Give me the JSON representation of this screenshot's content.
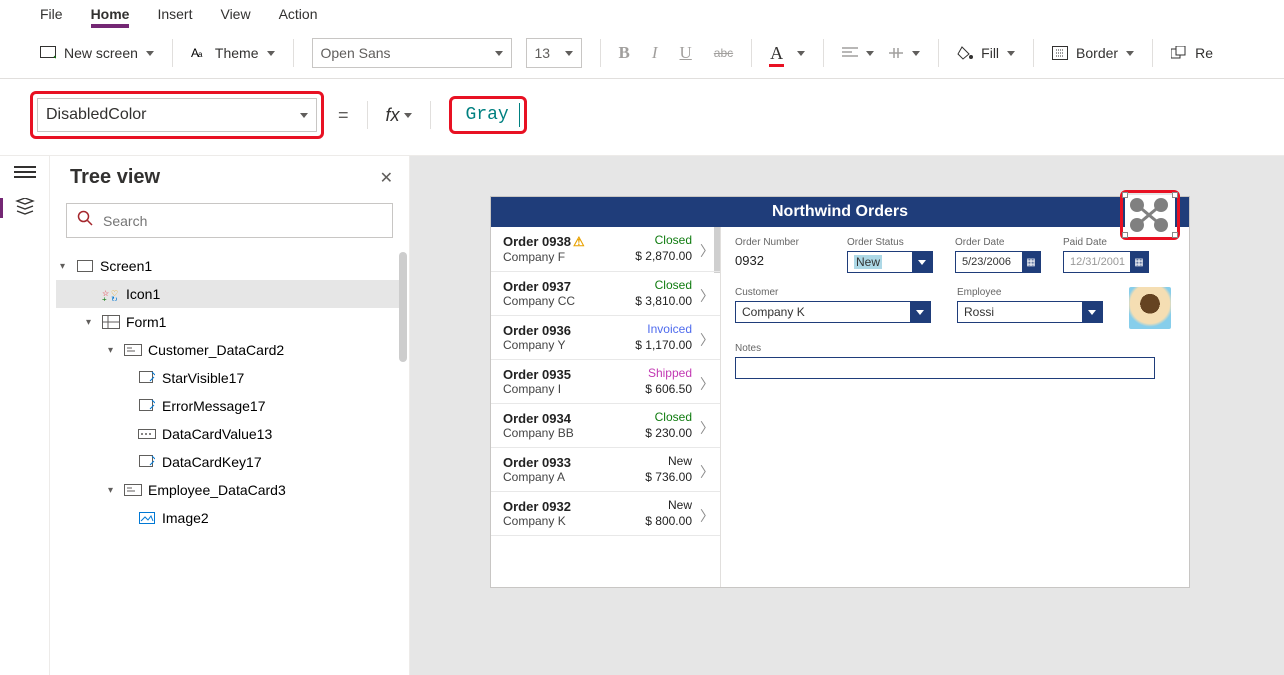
{
  "menu": {
    "file": "File",
    "home": "Home",
    "insert": "Insert",
    "view": "View",
    "action": "Action"
  },
  "toolbar": {
    "new_screen": "New screen",
    "theme": "Theme",
    "font_family": "Open Sans",
    "font_size": "13",
    "fill": "Fill",
    "border": "Border",
    "reorder": "Re"
  },
  "formula": {
    "property": "DisabledColor",
    "value": "Gray",
    "fx_label": "fx"
  },
  "panel": {
    "title": "Tree view",
    "search_placeholder": "Search"
  },
  "tree": {
    "screen1": "Screen1",
    "icon1": "Icon1",
    "form1": "Form1",
    "customer_card": "Customer_DataCard2",
    "starvisible": "StarVisible17",
    "errormessage": "ErrorMessage17",
    "datacardvalue": "DataCardValue13",
    "datacardkey": "DataCardKey17",
    "employee_card": "Employee_DataCard3",
    "image2": "Image2"
  },
  "app": {
    "title": "Northwind Orders",
    "list": [
      {
        "id": "Order 0938",
        "company": "Company F",
        "status": "Closed",
        "status_class": "st-closed",
        "amount": "$ 2,870.00",
        "warn": true
      },
      {
        "id": "Order 0937",
        "company": "Company CC",
        "status": "Closed",
        "status_class": "st-closed",
        "amount": "$ 3,810.00",
        "warn": false
      },
      {
        "id": "Order 0936",
        "company": "Company Y",
        "status": "Invoiced",
        "status_class": "st-invoiced",
        "amount": "$ 1,170.00",
        "warn": false
      },
      {
        "id": "Order 0935",
        "company": "Company I",
        "status": "Shipped",
        "status_class": "st-shipped",
        "amount": "$ 606.50",
        "warn": false
      },
      {
        "id": "Order 0934",
        "company": "Company BB",
        "status": "Closed",
        "status_class": "st-closed",
        "amount": "$ 230.00",
        "warn": false
      },
      {
        "id": "Order 0933",
        "company": "Company A",
        "status": "New",
        "status_class": "st-new",
        "amount": "$ 736.00",
        "warn": false
      },
      {
        "id": "Order 0932",
        "company": "Company K",
        "status": "New",
        "status_class": "st-new",
        "amount": "$ 800.00",
        "warn": false
      }
    ],
    "detail": {
      "order_number_lbl": "Order Number",
      "order_number": "0932",
      "order_status_lbl": "Order Status",
      "order_status": "New",
      "order_date_lbl": "Order Date",
      "order_date": "5/23/2006",
      "paid_date_lbl": "Paid Date",
      "paid_date": "12/31/2001",
      "customer_lbl": "Customer",
      "customer": "Company K",
      "employee_lbl": "Employee",
      "employee": "Rossi",
      "notes_lbl": "Notes"
    }
  }
}
